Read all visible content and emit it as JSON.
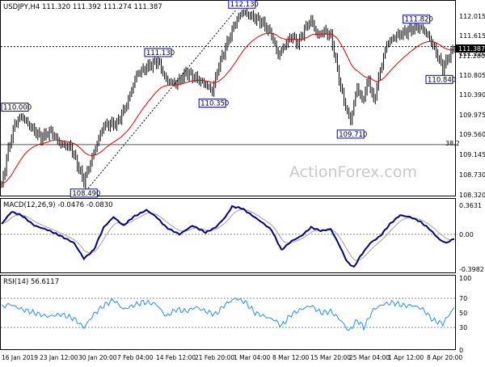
{
  "chart_data": {
    "type": "line",
    "symbol_header": "USDJPY,H4  111.320 111.392 111.274 111.387",
    "watermark": "ActionForex.com",
    "x_labels": [
      "16 Jan 2019",
      "23 Jan 12:00",
      "30 Jan 20:00",
      "7 Feb 04:00",
      "14 Feb 12:00",
      "21 Feb 20:00",
      "1 Mar 04:00",
      "8 Mar 12:00",
      "15 Mar 20:00",
      "25 Mar 04:00",
      "1 Apr 12:00",
      "8 Apr 20:00"
    ],
    "price": {
      "ylim": [
        108.32,
        112.15
      ],
      "y_ticks": [
        "112.015",
        "111.615",
        "111.220",
        "110.805",
        "110.390",
        "109.975",
        "109.560",
        "109.145",
        "108.730",
        "108.320"
      ],
      "price_label_1": "111.387",
      "price_label_2": "111.280",
      "fib_label": "38.2",
      "fib_level": 109.36,
      "current_price": 111.387,
      "annotations": [
        {
          "text": "110.000",
          "idx": 5,
          "value": 110.0
        },
        {
          "text": "108.490",
          "idx": 50,
          "value": 108.49
        },
        {
          "text": "111.130",
          "idx": 95,
          "value": 111.13
        },
        {
          "text": "110.350",
          "idx": 128,
          "value": 110.35
        },
        {
          "text": "112.130",
          "idx": 146,
          "value": 112.13
        },
        {
          "text": "109.710",
          "idx": 212,
          "value": 109.71
        },
        {
          "text": "111.820",
          "idx": 252,
          "value": 111.82
        },
        {
          "text": "110.840",
          "idx": 268,
          "value": 110.84
        }
      ],
      "anchors": [
        [
          0,
          108.5
        ],
        [
          4,
          109.25
        ],
        [
          8,
          109.8
        ],
        [
          12,
          109.95
        ],
        [
          18,
          109.7
        ],
        [
          24,
          109.5
        ],
        [
          30,
          109.65
        ],
        [
          36,
          109.35
        ],
        [
          42,
          109.3
        ],
        [
          46,
          108.95
        ],
        [
          50,
          108.6
        ],
        [
          56,
          109.2
        ],
        [
          62,
          109.75
        ],
        [
          70,
          109.8
        ],
        [
          76,
          110.2
        ],
        [
          82,
          110.8
        ],
        [
          88,
          110.95
        ],
        [
          95,
          111.1
        ],
        [
          100,
          110.7
        ],
        [
          106,
          110.6
        ],
        [
          112,
          110.85
        ],
        [
          118,
          110.75
        ],
        [
          124,
          110.6
        ],
        [
          128,
          110.45
        ],
        [
          132,
          111.0
        ],
        [
          138,
          111.55
        ],
        [
          142,
          111.9
        ],
        [
          146,
          112.1
        ],
        [
          152,
          112.0
        ],
        [
          158,
          111.9
        ],
        [
          164,
          111.65
        ],
        [
          168,
          111.2
        ],
        [
          172,
          111.4
        ],
        [
          176,
          111.6
        ],
        [
          180,
          111.45
        ],
        [
          184,
          111.75
        ],
        [
          188,
          111.95
        ],
        [
          192,
          111.6
        ],
        [
          196,
          111.7
        ],
        [
          200,
          111.6
        ],
        [
          203,
          111.1
        ],
        [
          206,
          110.55
        ],
        [
          209,
          110.15
        ],
        [
          212,
          109.85
        ],
        [
          216,
          110.55
        ],
        [
          219,
          110.25
        ],
        [
          223,
          110.7
        ],
        [
          226,
          110.25
        ],
        [
          230,
          110.9
        ],
        [
          234,
          111.45
        ],
        [
          240,
          111.6
        ],
        [
          246,
          111.7
        ],
        [
          252,
          111.8
        ],
        [
          256,
          111.75
        ],
        [
          260,
          111.55
        ],
        [
          264,
          111.25
        ],
        [
          268,
          110.95
        ],
        [
          272,
          111.2
        ],
        [
          275,
          111.39
        ]
      ]
    },
    "macd": {
      "label": "MACD(12,26,9) -0.0476 -0.0830",
      "ylim": [
        -0.43,
        0.39
      ],
      "y_ticks": [
        "0.3631",
        "0.00",
        "-0.3982"
      ],
      "anchors": [
        [
          0,
          0.12
        ],
        [
          6,
          0.26
        ],
        [
          12,
          0.22
        ],
        [
          20,
          0.1
        ],
        [
          28,
          0.05
        ],
        [
          36,
          -0.02
        ],
        [
          44,
          -0.1
        ],
        [
          50,
          -0.28
        ],
        [
          56,
          -0.18
        ],
        [
          62,
          0.08
        ],
        [
          68,
          0.2
        ],
        [
          74,
          0.1
        ],
        [
          80,
          0.2
        ],
        [
          88,
          0.28
        ],
        [
          94,
          0.2
        ],
        [
          100,
          0.08
        ],
        [
          108,
          0.0
        ],
        [
          116,
          0.1
        ],
        [
          124,
          0.02
        ],
        [
          130,
          0.08
        ],
        [
          136,
          0.2
        ],
        [
          140,
          0.32
        ],
        [
          146,
          0.3
        ],
        [
          152,
          0.22
        ],
        [
          158,
          0.14
        ],
        [
          164,
          0.05
        ],
        [
          170,
          -0.18
        ],
        [
          176,
          -0.08
        ],
        [
          182,
          -0.02
        ],
        [
          188,
          0.08
        ],
        [
          194,
          0.04
        ],
        [
          200,
          0.06
        ],
        [
          205,
          -0.12
        ],
        [
          210,
          -0.32
        ],
        [
          214,
          -0.38
        ],
        [
          218,
          -0.25
        ],
        [
          224,
          -0.1
        ],
        [
          230,
          -0.02
        ],
        [
          236,
          0.12
        ],
        [
          242,
          0.22
        ],
        [
          248,
          0.2
        ],
        [
          254,
          0.15
        ],
        [
          260,
          0.06
        ],
        [
          266,
          -0.06
        ],
        [
          270,
          -0.1
        ],
        [
          275,
          -0.05
        ]
      ]
    },
    "rsi": {
      "label": "RSI(14) 56.6117",
      "ylim": [
        0,
        100
      ],
      "y_ticks": [
        "100",
        "70",
        "50",
        "30",
        "0"
      ],
      "levels": [
        70,
        30
      ],
      "anchors": [
        [
          0,
          58
        ],
        [
          5,
          62
        ],
        [
          12,
          55
        ],
        [
          20,
          50
        ],
        [
          28,
          45
        ],
        [
          36,
          48
        ],
        [
          44,
          42
        ],
        [
          50,
          30
        ],
        [
          56,
          48
        ],
        [
          62,
          60
        ],
        [
          68,
          68
        ],
        [
          74,
          55
        ],
        [
          80,
          60
        ],
        [
          86,
          65
        ],
        [
          94,
          62
        ],
        [
          100,
          45
        ],
        [
          106,
          55
        ],
        [
          112,
          52
        ],
        [
          118,
          58
        ],
        [
          124,
          52
        ],
        [
          130,
          48
        ],
        [
          136,
          62
        ],
        [
          142,
          70
        ],
        [
          148,
          65
        ],
        [
          154,
          50
        ],
        [
          160,
          45
        ],
        [
          166,
          40
        ],
        [
          170,
          32
        ],
        [
          176,
          48
        ],
        [
          182,
          55
        ],
        [
          188,
          60
        ],
        [
          194,
          50
        ],
        [
          200,
          52
        ],
        [
          206,
          40
        ],
        [
          211,
          25
        ],
        [
          216,
          40
        ],
        [
          220,
          30
        ],
        [
          226,
          55
        ],
        [
          232,
          62
        ],
        [
          238,
          64
        ],
        [
          244,
          60
        ],
        [
          250,
          60
        ],
        [
          256,
          55
        ],
        [
          262,
          40
        ],
        [
          268,
          35
        ],
        [
          272,
          48
        ],
        [
          275,
          57
        ]
      ]
    }
  }
}
